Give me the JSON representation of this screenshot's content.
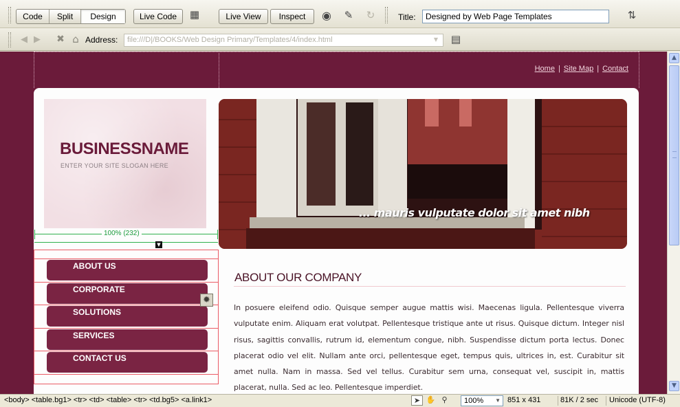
{
  "toolbar": {
    "view_modes": [
      "Code",
      "Split",
      "Design"
    ],
    "active_view": "Design",
    "live_code_label": "Live Code",
    "live_view_label": "Live View",
    "inspect_label": "Inspect",
    "title_label": "Title:",
    "title_value": "Designed by Web Page Templates"
  },
  "address_bar": {
    "label": "Address:",
    "value": "file:///D|/BOOKS/Web Design Primary/Templates/4/index.html"
  },
  "page": {
    "top_links": [
      "Home",
      "Site Map",
      "Contact"
    ],
    "top_link_separator": "|",
    "business_name": "BUSINESSNAME",
    "slogan": "ENTER YOUR SITE SLOGAN HERE",
    "hero_caption": "... mauris vulputate dolor sit amet nibh",
    "table_width_indicator": "100% (232)",
    "nav_items": [
      "ABOUT US",
      "CORPORATE",
      "SOLUTIONS",
      "SERVICES",
      "CONTACT US"
    ],
    "about_heading": "ABOUT OUR COMPANY",
    "about_text": "In posuere eleifend odio. Quisque semper augue mattis wisi. Maecenas ligula. Pellentesque viverra vulputate enim. Aliquam erat volutpat. Pellentesque tristique ante ut risus. Quisque dictum. Integer nisl risus, sagittis convallis, rutrum id, elementum congue, nibh. Suspendisse dictum porta lectus. Donec placerat odio vel elit. Nullam ante orci, pellentesque eget, tempus quis, ultrices in, est. Curabitur sit amet nulla. Nam in massa. Sed vel tellus. Curabitur sem urna, consequat vel, suscipit in, mattis placerat, nulla. Sed ac leo. Pellentesque imperdiet."
  },
  "status_bar": {
    "tag_selector": "<body> <table.bg1> <tr> <td> <table> <tr> <td.bg5> <a.link1>",
    "zoom": "100%",
    "window_size": "851 x 431",
    "download": "81K / 2 sec",
    "encoding": "Unicode (UTF-8)"
  },
  "colors": {
    "page_bg": "#6b1b3a",
    "nav_button": "#7a2443",
    "heading": "#4a1326"
  },
  "icons": {
    "toolbar": [
      "design-view-options-icon",
      "browser-preview-icon",
      "validate-icon",
      "refresh-icon",
      "file-management-icon"
    ],
    "address": [
      "back-icon",
      "forward-icon",
      "stop-icon",
      "home-icon",
      "address-options-icon"
    ],
    "status_tools": [
      "pointer-icon",
      "hand-icon",
      "zoom-icon"
    ]
  }
}
